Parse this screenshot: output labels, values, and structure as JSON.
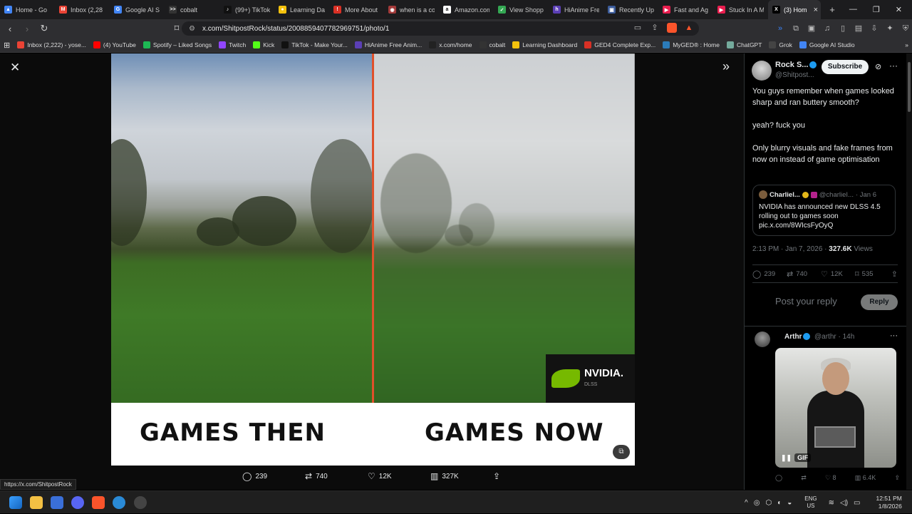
{
  "browser": {
    "tabs": [
      {
        "label": "Home - Go",
        "color": "#4285f4",
        "glyph": "▲"
      },
      {
        "label": "Inbox (2,28",
        "color": "#ea4335",
        "glyph": "M"
      },
      {
        "label": "Google AI S",
        "color": "#4285f4",
        "glyph": "G"
      },
      {
        "label": "cobalt",
        "color": "#333333",
        "glyph": ">>"
      },
      {
        "label": "(99+) TikTok",
        "color": "#111111",
        "glyph": "♪"
      },
      {
        "label": "Learning Da",
        "color": "#f4c20d",
        "glyph": "●"
      },
      {
        "label": "More About",
        "color": "#d93025",
        "glyph": "!"
      },
      {
        "label": "when is a co",
        "color": "#a33a3a",
        "glyph": "◉"
      },
      {
        "label": "Amazon.com",
        "color": "#ffffff",
        "glyph": "a"
      },
      {
        "label": "View Shopp",
        "color": "#34a853",
        "glyph": "✓"
      },
      {
        "label": "HiAnime Fre",
        "color": "#5b3fb5",
        "glyph": "h"
      },
      {
        "label": "Recently Up",
        "color": "#3b5b9a",
        "glyph": "▣"
      },
      {
        "label": "Fast and Ag",
        "color": "#e91e4f",
        "glyph": "▶"
      },
      {
        "label": "Stuck In A M",
        "color": "#e91e4f",
        "glyph": "▶"
      }
    ],
    "active_tab": {
      "label": "(3) Hom",
      "glyph": "X"
    },
    "url": "x.com/ShitpostRock/status/2008859407782969751/photo/1",
    "bookmarks": [
      {
        "label": "Inbox (2,222) - yose...",
        "color": "#ea4335"
      },
      {
        "label": "(4) YouTube",
        "color": "#ff0000"
      },
      {
        "label": "Spotify – Liked Songs",
        "color": "#1db954"
      },
      {
        "label": "Twitch",
        "color": "#9146ff"
      },
      {
        "label": "Kick",
        "color": "#53fc18"
      },
      {
        "label": "TikTok - Make Your...",
        "color": "#111111"
      },
      {
        "label": "HiAnime Free Anim...",
        "color": "#5b3fb5"
      },
      {
        "label": "x.com/home",
        "color": "#222222"
      },
      {
        "label": "cobalt",
        "color": "#333333"
      },
      {
        "label": "Learning Dashboard",
        "color": "#f4c20d"
      },
      {
        "label": "GED4 Complete Exp...",
        "color": "#d93025"
      },
      {
        "label": "MyGED® : Home",
        "color": "#2b7bb9"
      },
      {
        "label": "ChatGPT",
        "color": "#74aa9c"
      },
      {
        "label": "Grok",
        "color": "#444444"
      },
      {
        "label": "Google AI Studio",
        "color": "#4285f4"
      }
    ]
  },
  "media": {
    "caption_left": "GAMES THEN",
    "caption_right": "GAMES NOW",
    "logo_text": "NVIDIA.",
    "logo_sub": "DLSS"
  },
  "media_actions": {
    "replies": "239",
    "reposts": "740",
    "likes": "12K",
    "views": "327K"
  },
  "status_bar_url": "https://x.com/ShitpostRock",
  "tweet": {
    "author_name": "Rock S...",
    "author_handle": "@Shitpost...",
    "subscribe_label": "Subscribe",
    "text_1": "You guys remember when games looked sharp and ran buttery smooth?",
    "text_2": "yeah? fuck you",
    "text_3": "Only blurry visuals and fake frames from now on instead of game optimisation",
    "quote": {
      "name": "Charliel...",
      "handle": "@charlieI...",
      "date": "· Jan 6",
      "text": "NVIDIA has announced new DLSS 4.5 rolling out to games soon pic.x.com/8WIcsFyOyQ"
    },
    "time": "2:13 PM · Jan 7, 2026 ·",
    "views_count": "327.6K",
    "views_label": "Views",
    "stats": {
      "replies": "239",
      "reposts": "740",
      "likes": "12K",
      "bookmarks": "535"
    },
    "reply_placeholder": "Post your reply",
    "reply_button": "Reply"
  },
  "reply": {
    "name": "Arthr",
    "handle": "@arthr · 14h",
    "gif_label": "GIF",
    "stats": {
      "likes": "8",
      "views": "6.4K"
    }
  },
  "taskbar": {
    "lang_1": "ENG",
    "lang_2": "US",
    "time": "12:51 PM",
    "date": "1/8/2026"
  }
}
